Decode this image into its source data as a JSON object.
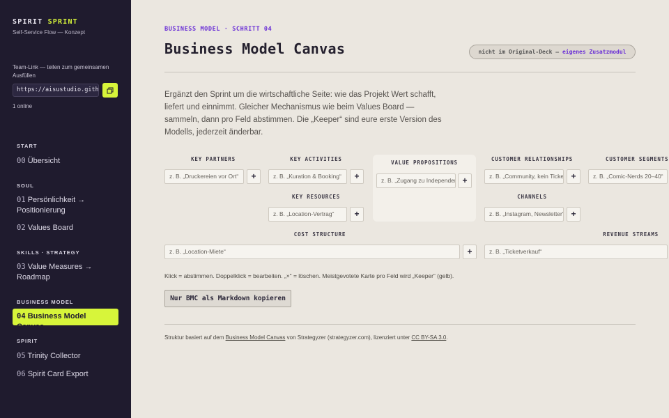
{
  "sidebar": {
    "brand_primary": "SPIRIT",
    "brand_accent": "SPRINT",
    "brand_subtitle": "Self-Service Flow — Konzept",
    "team_link_label": "Team-Link — teilen zum gemeinsamen Ausfüllen",
    "team_link_value": "https://aisustudio.gith",
    "copy_icon": "copy-icon",
    "online_status": "1 online",
    "sections": {
      "start": "START",
      "soul": "SOUL",
      "skills": "SKILLS · STRATEGY",
      "business": "BUSINESS MODEL",
      "spirit": "SPIRIT"
    },
    "items": [
      {
        "num": "00",
        "label": "Übersicht"
      },
      {
        "num": "01",
        "label": "Persönlichkeit → Positionierung"
      },
      {
        "num": "02",
        "label": "Values Board"
      },
      {
        "num": "03",
        "label": "Value Measures → Roadmap"
      },
      {
        "num": "04",
        "label": "Business Model Canvas"
      },
      {
        "num": "05",
        "label": "Trinity Collector"
      },
      {
        "num": "06",
        "label": "Spirit Card Export"
      }
    ],
    "accent_color": "#d7f53a",
    "background_color": "#1f1b2e"
  },
  "header": {
    "eyebrow": "BUSINESS MODEL · SCHRITT 04",
    "title": "Business Model Canvas",
    "badge_text": "nicht im Original-Deck — ",
    "badge_highlight": "eigenes Zusatzmodul"
  },
  "intro": "Ergänzt den Sprint um die wirtschaftliche Seite: wie das Projekt Wert schafft, liefert und einnimmt. Gleicher Mechanismus wie beim Values Board — sammeln, dann pro Feld abstimmen. Die „Keeper“ sind eure erste Version des Modells, jederzeit änderbar.",
  "canvas": {
    "key_partners": {
      "label": "KEY PARTNERS",
      "placeholder": "z. B. „Druckereien vor Ort“"
    },
    "key_activities": {
      "label": "KEY ACTIVITIES",
      "placeholder": "z. B. „Kuration & Booking“"
    },
    "key_resources": {
      "label": "KEY RESOURCES",
      "placeholder": "z. B. „Location-Vertrag“"
    },
    "value_propositions": {
      "label": "VALUE PROPOSITIONS",
      "placeholder": "z. B. „Zugang zu Independent“"
    },
    "customer_relationships": {
      "label": "CUSTOMER RELATIONSHIPS",
      "placeholder": "z. B. „Community, kein Ticket“"
    },
    "channels": {
      "label": "CHANNELS",
      "placeholder": "z. B. „Instagram, Newsletter“"
    },
    "customer_segments": {
      "label": "CUSTOMER SEGMENTS",
      "placeholder": "z. B. „Comic-Nerds 20–40“"
    },
    "cost_structure": {
      "label": "COST STRUCTURE",
      "placeholder": "z. B. „Location-Miete“"
    },
    "revenue_streams": {
      "label": "REVENUE STREAMS",
      "placeholder": "z. B. „Ticketverkauf“"
    },
    "add_label": "+"
  },
  "hint": "Klick = abstimmen. Doppelklick = bearbeiten. „×“ = löschen. Meistgevotete Karte pro Feld wird „Keeper“ (gelb).",
  "copy_markdown_label": "Nur BMC als Markdown kopieren",
  "footer": {
    "prefix": "Struktur basiert auf dem ",
    "link1": "Business Model Canvas",
    "middle": " von Strategyzer (strategyzer.com), lizenziert unter ",
    "link2": "CC BY-SA 3.0",
    "suffix": "."
  },
  "colors": {
    "page_background": "#ebe7e0",
    "eyebrow_purple": "#6a2fd6"
  }
}
